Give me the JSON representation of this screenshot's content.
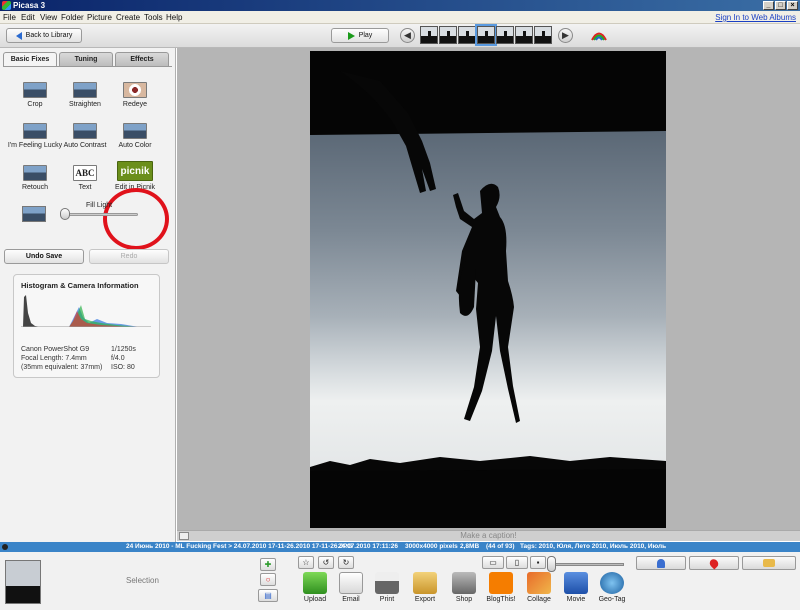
{
  "window": {
    "title": "Picasa 3"
  },
  "menu": [
    "File",
    "Edit",
    "View",
    "Folder",
    "Picture",
    "Create",
    "Tools",
    "Help"
  ],
  "signin": "Sign In to Web Albums",
  "toolbar": {
    "back_label": "Back to Library",
    "play_label": "Play"
  },
  "tabs": [
    "Basic Fixes",
    "Tuning",
    "Effects"
  ],
  "fixes": {
    "crop": "Crop",
    "straighten": "Straighten",
    "redeye": "Redeye",
    "lucky": "I'm Feeling Lucky",
    "contrast": "Auto Contrast",
    "color": "Auto Color",
    "retouch": "Retouch",
    "text": "Text",
    "text_icon": "ABC",
    "picnik": "Edit in Picnik",
    "picnik_icon": "picnik",
    "fill_light": "Fill Light"
  },
  "fill_light_level": 0,
  "undo_label": "Undo Save",
  "redo_label": "Redo",
  "histogram": {
    "title": "Histogram & Camera Information",
    "camera": "Canon PowerShot G9",
    "focal": "Focal Length: 7.4mm",
    "equiv": "(35mm equivalent: 37mm)",
    "shutter": "1/1250s",
    "aperture": "f/4.0",
    "iso": "ISO: 80"
  },
  "caption": "Make a caption!",
  "status": {
    "path": "24 Июнь 2010 - ML Fucking Fest > 24.07.2010 17-11-26.2010 17-11-26.JPG",
    "date": "24.07.2010 17:11:26",
    "dims": "3000x4000 pixels",
    "size": "2,8MB",
    "index": "(44 of 93)",
    "tags": "Tags: 2010, Юля, Лето 2010, Июль 2010, Июль"
  },
  "tray": {
    "selection": "Selection",
    "actions": [
      "Upload",
      "Email",
      "Print",
      "Export",
      "Shop",
      "BlogThis!",
      "Collage",
      "Movie",
      "Geo-Tag"
    ]
  },
  "icons": {
    "back": "arrow-left-icon",
    "play": "play-icon",
    "prev": "prev-arrow-icon",
    "next": "next-arrow-icon"
  },
  "colors": {
    "statusbar": "#3a84c8",
    "picnik_ring": "#e0121b",
    "picnik_green": "#6b8f1b"
  }
}
